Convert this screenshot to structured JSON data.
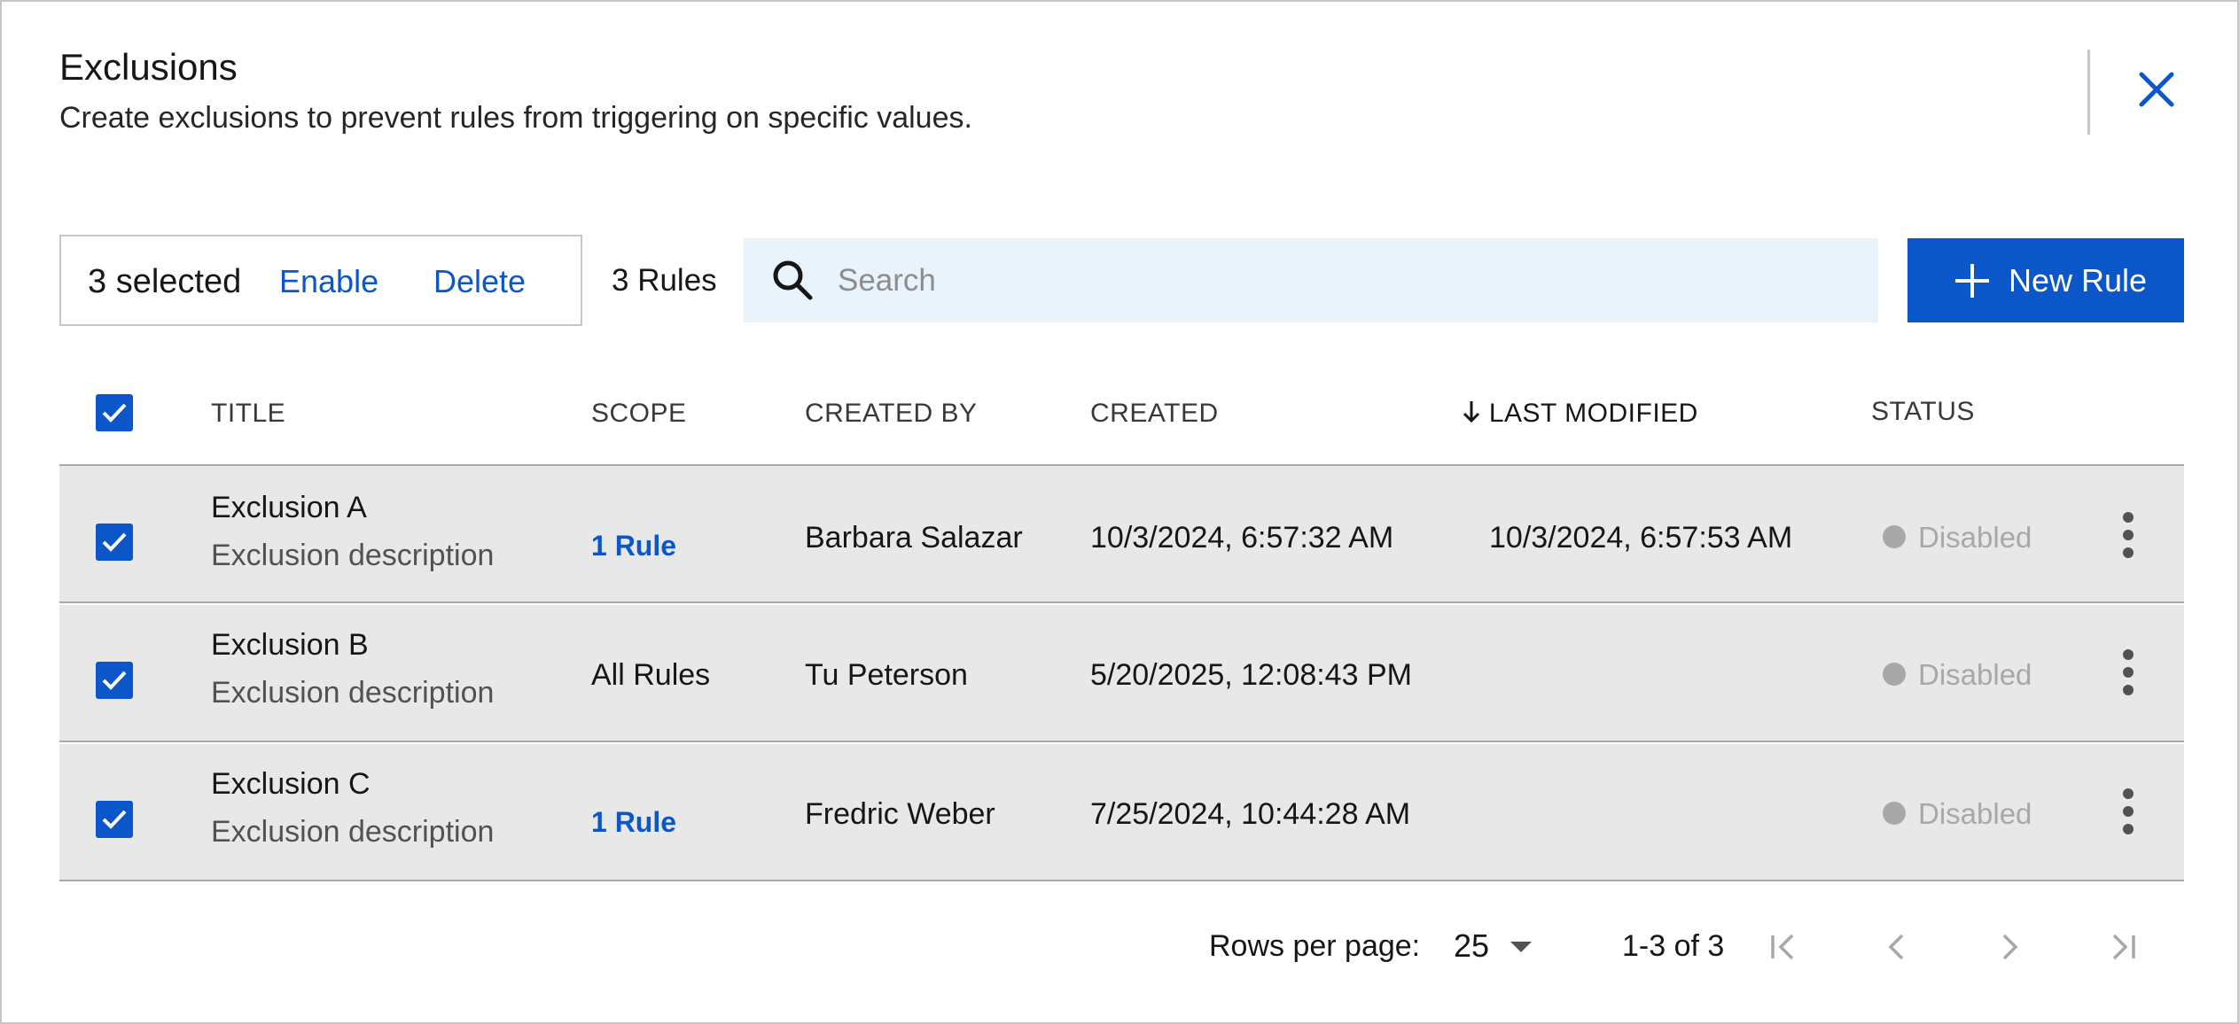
{
  "header": {
    "title": "Exclusions",
    "subtitle": "Create exclusions to prevent rules from triggering on specific values."
  },
  "toolbar": {
    "selected_count": "3 selected",
    "enable_label": "Enable",
    "delete_label": "Delete",
    "rules_count": "3 Rules",
    "search_placeholder": "Search",
    "search_value": "",
    "new_rule_label": "New Rule"
  },
  "table": {
    "columns": [
      "TITLE",
      "SCOPE",
      "CREATED BY",
      "CREATED",
      "LAST MODIFIED",
      "STATUS"
    ],
    "sorted_column": "LAST MODIFIED",
    "sort_direction": "descending",
    "rows": [
      {
        "title": "Exclusion A",
        "description": "Exclusion description",
        "scope": "1 Rule",
        "created_by": "Barbara Salazar",
        "created": "10/3/2024, 6:57:32 AM",
        "last_modified": "10/3/2024, 6:57:53 AM",
        "status": "Disabled",
        "selected": true
      },
      {
        "title": "Exclusion B",
        "description": "Exclusion description",
        "scope": "All Rules",
        "created_by": "Tu Peterson",
        "created": "5/20/2025, 12:08:43 PM",
        "last_modified": "",
        "status": "Disabled",
        "selected": true
      },
      {
        "title": "Exclusion C",
        "description": "Exclusion description",
        "scope": "1 Rule",
        "created_by": "Fredric Weber",
        "created": "7/25/2024, 10:44:28 AM",
        "last_modified": "",
        "status": "Disabled",
        "selected": true
      }
    ]
  },
  "pagination": {
    "rows_per_page_label": "Rows per page:",
    "rows_per_page": "25",
    "range": "1-3 of 3"
  },
  "colors": {
    "accent": "#0b57c9",
    "search_bg": "#e9f3fc",
    "row_bg": "#e8e8e8",
    "status_disabled": "#a8a8a8"
  },
  "icons": {
    "close": "close-icon",
    "search": "search-icon",
    "new_rule": "plus-icon",
    "sort": "arrow-down-icon",
    "row_menu": "overflow-menu-vertical-icon",
    "rows_dropdown": "caret-down-icon",
    "first": "page-first-icon",
    "prev": "chevron-left-icon",
    "next": "chevron-right-icon",
    "last": "page-last-icon"
  }
}
